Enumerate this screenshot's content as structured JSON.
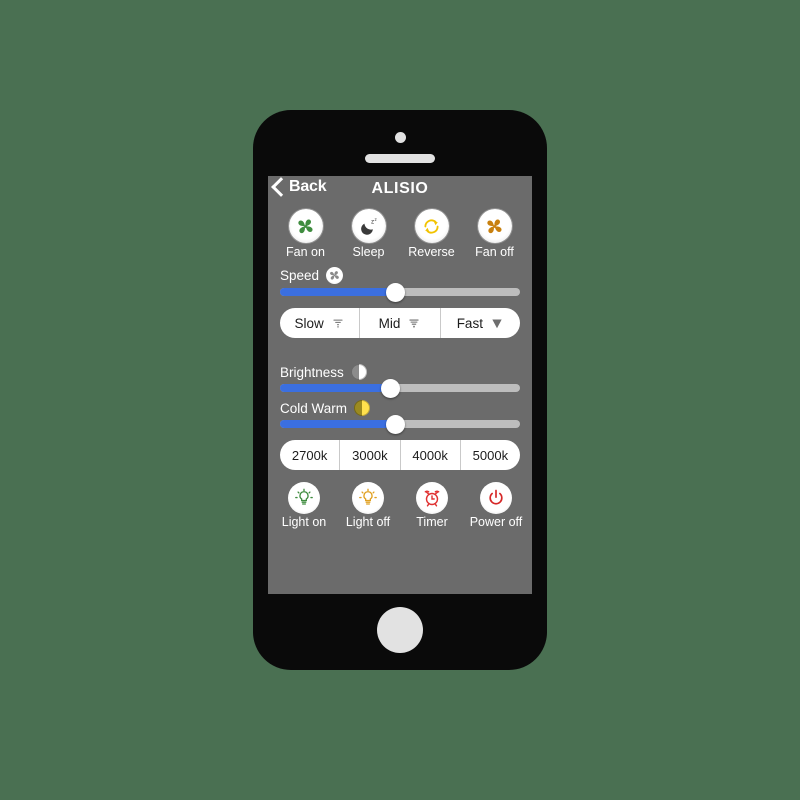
{
  "theme": {
    "page_background": "#4a7052",
    "phone_body": "#0a0a0a",
    "screen_background": "#6b6b6b",
    "slider_fill": "#3b6fe0",
    "slider_track": "#bdbdbd",
    "accent_green": "#3f8c3f",
    "accent_orange": "#c8800f",
    "accent_yellow": "#f2c300",
    "accent_red": "#e03131",
    "accent_warm": "#ffe14d"
  },
  "nav": {
    "back_label": "Back",
    "back_icon": "chevron-left-icon",
    "title": "ALISIO"
  },
  "modes": [
    {
      "label": "Fan on",
      "icon": "fan-icon",
      "color": "#3f8c3f"
    },
    {
      "label": "Sleep",
      "icon": "moon-sleep-icon",
      "color": "#3a3a3a"
    },
    {
      "label": "Reverse",
      "icon": "circular-arrows-icon",
      "color": "#f2c300"
    },
    {
      "label": "Fan off",
      "icon": "fan-icon",
      "color": "#c8800f"
    }
  ],
  "speed": {
    "label": "Speed",
    "icon": "fan-icon",
    "slider_value": 48,
    "options": [
      {
        "label": "Slow",
        "icon": "wind-low-icon"
      },
      {
        "label": "Mid",
        "icon": "wind-mid-icon"
      },
      {
        "label": "Fast",
        "icon": "wind-high-icon"
      }
    ]
  },
  "brightness": {
    "label": "Brightness",
    "icon": "half-circle-icon",
    "slider_value": 46
  },
  "cold_warm": {
    "label": "Cold Warm",
    "icon": "half-circle-warm-icon",
    "slider_value": 48
  },
  "temperatures": [
    {
      "label": "2700k"
    },
    {
      "label": "3000k"
    },
    {
      "label": "4000k"
    },
    {
      "label": "5000k"
    }
  ],
  "actions": [
    {
      "label": "Light on",
      "icon": "bulb-on-icon",
      "color": "#3f8c3f"
    },
    {
      "label": "Light off",
      "icon": "bulb-off-icon",
      "color": "#e0a020"
    },
    {
      "label": "Timer",
      "icon": "alarm-clock-icon",
      "color": "#e03131"
    },
    {
      "label": "Power off",
      "icon": "power-icon",
      "color": "#d62828"
    }
  ]
}
